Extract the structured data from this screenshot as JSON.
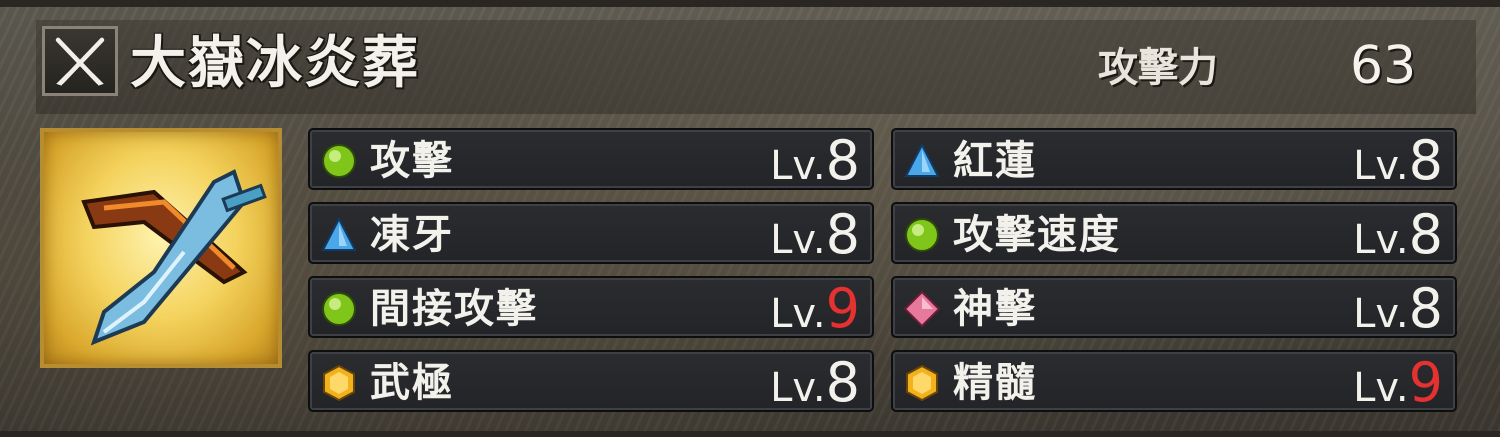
{
  "weapon": {
    "name": "大嶽冰炎葬",
    "type_icon": "dual-blades-icon",
    "portrait_icon": "ice-fire-blades-portrait",
    "attack_label": "攻擊力",
    "attack_value": "63"
  },
  "colors": {
    "max_level": "#e5312f",
    "green_gem": "#7fc51a",
    "blue_gem": "#4aa8e8",
    "pink_gem": "#e77a9c",
    "gold_gem": "#f2b21c"
  },
  "skills": [
    {
      "name": "攻擊",
      "icon": "green-orb-icon",
      "lv_prefix": "Lv.",
      "level": "8"
    },
    {
      "name": "紅蓮",
      "icon": "blue-triangle-icon",
      "lv_prefix": "Lv.",
      "level": "8"
    },
    {
      "name": "凍牙",
      "icon": "blue-triangle-icon",
      "lv_prefix": "Lv.",
      "level": "8"
    },
    {
      "name": "攻擊速度",
      "icon": "green-orb-icon",
      "lv_prefix": "Lv.",
      "level": "8"
    },
    {
      "name": "間接攻擊",
      "icon": "green-orb-icon",
      "lv_prefix": "Lv.",
      "level": "9"
    },
    {
      "name": "神擊",
      "icon": "pink-diamond-icon",
      "lv_prefix": "Lv.",
      "level": "8"
    },
    {
      "name": "武極",
      "icon": "gold-hexagon-icon",
      "lv_prefix": "Lv.",
      "level": "8"
    },
    {
      "name": "精髓",
      "icon": "gold-hexagon-icon",
      "lv_prefix": "Lv.",
      "level": "9"
    }
  ]
}
